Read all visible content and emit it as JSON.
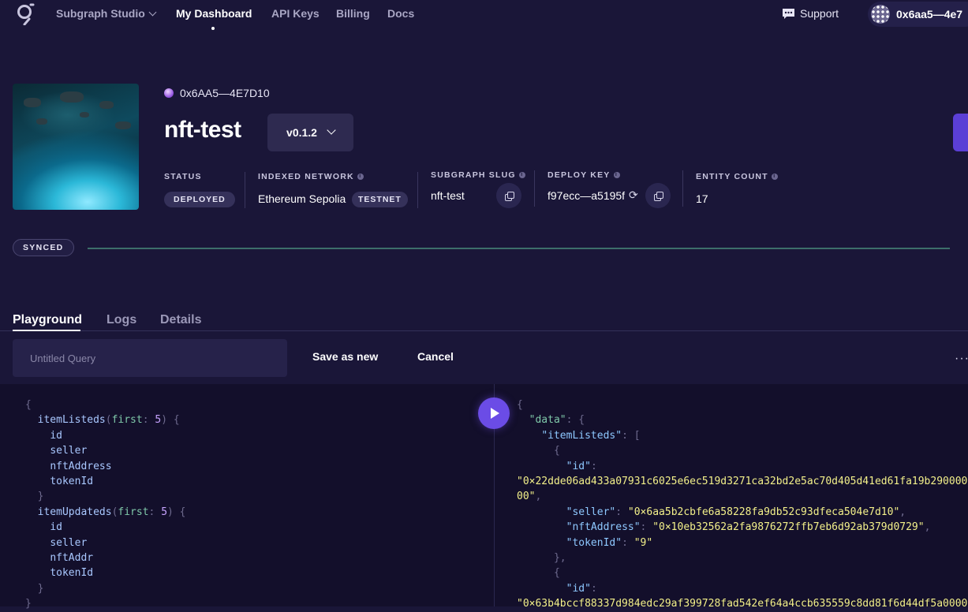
{
  "nav": {
    "studio_label": "Subgraph Studio",
    "items": [
      {
        "label": "My Dashboard"
      },
      {
        "label": "API Keys"
      },
      {
        "label": "Billing"
      },
      {
        "label": "Docs"
      }
    ],
    "support_label": "Support",
    "account_label": "0x6aa5—4e7"
  },
  "subgraph": {
    "owner": "0x6AA5—4E7D10",
    "name": "nft-test",
    "version": "v0.1.2",
    "stats": {
      "status": {
        "label": "STATUS",
        "value": "DEPLOYED"
      },
      "network": {
        "label": "INDEXED NETWORK",
        "value": "Ethereum Sepolia",
        "badge": "TESTNET"
      },
      "slug": {
        "label": "SUBGRAPH SLUG",
        "value": "nft-test"
      },
      "deploy_key": {
        "label": "DEPLOY KEY",
        "value": "f97ecc—a5195f"
      },
      "entity_count": {
        "label": "ENTITY COUNT",
        "value": "17"
      }
    }
  },
  "sync": {
    "label": "SYNCED"
  },
  "tabs": [
    {
      "label": "Playground"
    },
    {
      "label": "Logs"
    },
    {
      "label": "Details"
    }
  ],
  "query_bar": {
    "placeholder": "Untitled Query",
    "save_label": "Save as new",
    "cancel_label": "Cancel",
    "more_label": "···"
  },
  "editor": {
    "query": {
      "block1_name": "itemListeds",
      "block2_name": "itemUpdateds",
      "arg_name": "first",
      "arg_value": "5",
      "fields1": [
        "id",
        "seller",
        "nftAddress",
        "tokenId"
      ],
      "fields2": [
        "id",
        "seller",
        "nftAddr",
        "tokenId"
      ]
    },
    "result": {
      "data_key": "\"data\"",
      "list_key": "\"itemListeds\"",
      "id_key": "\"id\"",
      "seller_key": "\"seller\"",
      "nft_key": "\"nftAddress\"",
      "token_key": "\"tokenId\"",
      "item1": {
        "id_line1": "\"0×22dde06ad433a07931c6025e6ec519d3271ca32bd2e5ac70d405d41ed61fa19b290000",
        "id_line2": "00\"",
        "seller": "\"0×6aa5b2cbfe6a58228fa9db52c93dfeca504e7d10\"",
        "nftAddress": "\"0×10eb32562a2fa9876272ffb7eb6d92ab379d0729\"",
        "tokenId": "\"9\""
      },
      "item2": {
        "id_line1": "\"0×63b4bccf88337d984edc29af399728fad542ef64a4ccb635559c8dd81f6d44df5a0000"
      }
    }
  },
  "colors": {
    "background": "#1a1638",
    "accent": "#6b4ce6",
    "editor_bg": "#130f2b"
  }
}
